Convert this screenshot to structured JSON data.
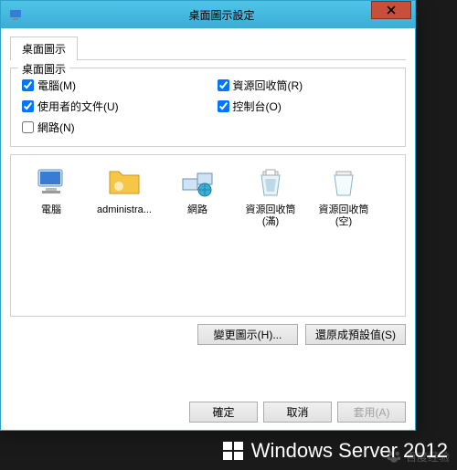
{
  "window": {
    "title": "桌面圖示設定",
    "close_label": "Close"
  },
  "tab": {
    "label": "桌面圖示"
  },
  "group": {
    "title": "桌面圖示",
    "checks": {
      "computer": {
        "label": "電腦(M)",
        "checked": true
      },
      "recycle": {
        "label": "資源回收筒(R)",
        "checked": true
      },
      "userfiles": {
        "label": "使用者的文件(U)",
        "checked": true
      },
      "control": {
        "label": "控制台(O)",
        "checked": true
      },
      "network": {
        "label": "網路(N)",
        "checked": false
      }
    }
  },
  "icons": [
    {
      "name": "電腦",
      "icon": "computer"
    },
    {
      "name": "administra...",
      "icon": "userfolder"
    },
    {
      "name": "網路",
      "icon": "network"
    },
    {
      "name": "資源回收筒 (滿)",
      "icon": "recycle-full"
    },
    {
      "name": "資源回收筒 (空)",
      "icon": "recycle-empty"
    }
  ],
  "buttons": {
    "change_icon": "變更圖示(H)...",
    "restore_default": "還原成預設值(S)",
    "ok": "確定",
    "cancel": "取消",
    "apply": "套用(A)"
  },
  "branding": {
    "text": "Windows Server 2012"
  },
  "watermark": {
    "text": "百度经验"
  }
}
